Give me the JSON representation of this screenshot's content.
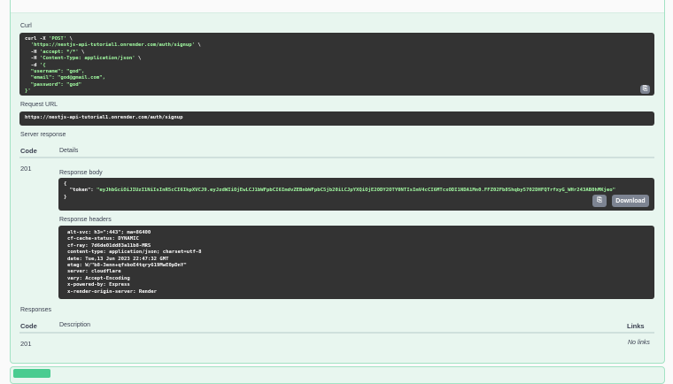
{
  "curl": {
    "label": "Curl",
    "lines": [
      [
        "curl -X ",
        "'POST'",
        " \\"
      ],
      [
        "  ",
        "'https://nestjs-api-tutorial1.onrender.com/auth/signup'",
        " \\"
      ],
      [
        "  -H ",
        "'accept: */*'",
        " \\"
      ],
      [
        "  -H ",
        "'Content-Type: application/json'",
        " \\"
      ],
      [
        "  -d ",
        "'{",
        ""
      ],
      [
        "  ",
        "\"username\": \"god\",",
        ""
      ],
      [
        "  ",
        "\"email\": \"god@gmail.com\",",
        ""
      ],
      [
        "  ",
        "\"password\": \"god\"",
        ""
      ],
      [
        "",
        "}'",
        ""
      ]
    ]
  },
  "request_url": {
    "label": "Request URL",
    "value": "https://nestjs-api-tutorial1.onrender.com/auth/signup"
  },
  "server_response": {
    "label": "Server response",
    "code_header": "Code",
    "details_header": "Details",
    "code": "201",
    "body_label": "Response body",
    "body_open": "{",
    "token_key": "  \"token\": ",
    "token_value": "\"eyJhbGciOiJIUzI1NiIsInR5cCI6IkpXVCJ9.eyJzdWIiOjEwLCJ1bWFpbCI6ImdvZEBnbWFpbC5jb20iLCJpYXQiOjE2ODY2OTY0NTIsImV4cCI6MTcxODI1NDA1Mn0.FFZ02Fb8Shqby5702DHFQTrfxyG_WHr243AB0hMKjeo\"",
    "body_close": "}",
    "download": "Download",
    "headers_label": "Response headers",
    "headers": [
      "alt-svc: h3=\":443\"; ma=86400",
      "cf-cache-status: DYNAMIC",
      "cf-ray: 7d6de01dd83a11b8-MRS",
      "content-type: application/json; charset=utf-8",
      "date: Tue,13 Jun 2023 22:47:32 GMT",
      "etag: W/\"b8-3enn+qfsboE4tqry619MwE0pDnY\"",
      "server: cloudflare",
      "vary: Accept-Encoding",
      "x-powered-by: Express",
      "x-render-origin-server: Render"
    ]
  },
  "responses": {
    "label": "Responses",
    "code_header": "Code",
    "description_header": "Description",
    "links_header": "Links",
    "rows": [
      {
        "code": "201",
        "description": "",
        "links": "No links"
      }
    ]
  }
}
